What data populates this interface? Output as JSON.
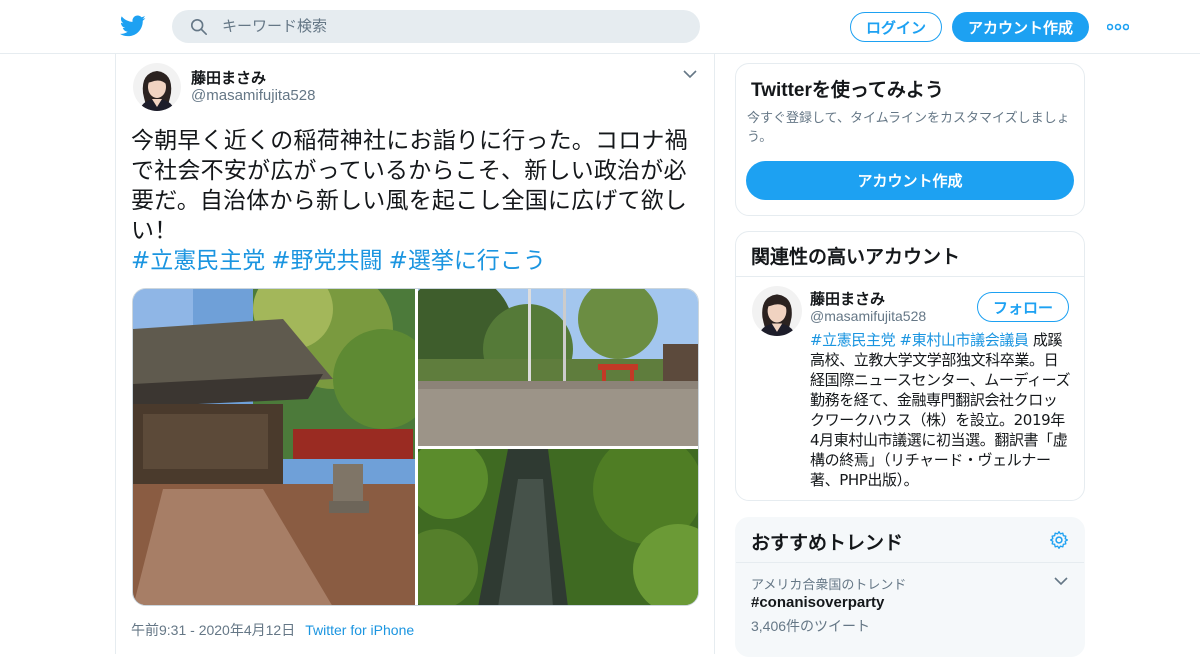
{
  "header": {
    "search_placeholder": "キーワード検索",
    "login_label": "ログイン",
    "signup_label": "アカウント作成"
  },
  "tweet": {
    "author_name": "藤田まさみ",
    "author_handle": "@masamifujita528",
    "text": "今朝早く近くの稲荷神社にお詣りに行った。コロナ禍で社会不安が広がっているからこそ、新しい政治が必要だ。自治体から新しい風を起こし全国に広げて欲しい！",
    "hashtags": [
      "#立憲民主党",
      "#野党共闘",
      "#選挙に行こう"
    ],
    "timestamp": "午前9:31 - 2020年4月12日",
    "source": "Twitter for iPhone"
  },
  "signup_card": {
    "title": "Twitterを使ってみよう",
    "description": "今すぐ登録して、タイムラインをカスタマイズしましょう。",
    "button_label": "アカウント作成"
  },
  "related_card": {
    "title": "関連性の高いアカウント",
    "name": "藤田まさみ",
    "handle": "@masamifujita528",
    "follow_label": "フォロー",
    "bio_tags": [
      "#立憲民主党",
      "#東村山市議会議員"
    ],
    "bio_text": "成蹊高校、立教大学文学部独文科卒業。日経国際ニュースセンター、ムーディーズ勤務を経て、金融専門翻訳会社クロックワークハウス（株）を設立。2019年4月東村山市議選に初当選。翻訳書「虚構の終焉」（リチャード・ヴェルナー著、PHP出版）。"
  },
  "trends_card": {
    "title": "おすすめトレンド",
    "context": "アメリカ合衆国のトレンド",
    "trend": "#conanisoverparty",
    "count": "3,406件のツイート"
  },
  "colors": {
    "brand": "#1da1f2",
    "link": "#1b95e0",
    "muted": "#657786"
  }
}
